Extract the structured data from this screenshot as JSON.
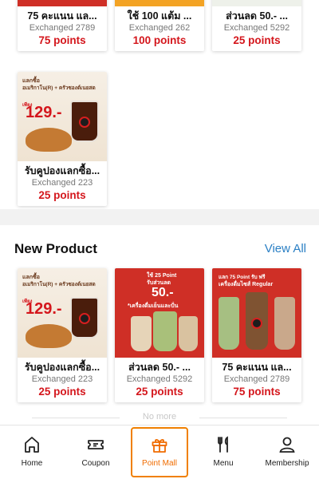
{
  "top_row": [
    {
      "name": "75 คะแนน แล...",
      "exchanged": "Exchanged 2789",
      "points": "75 points"
    },
    {
      "name": "ใช้ 100 แต้ม ...",
      "exchanged": "Exchanged 262",
      "points": "100 points"
    },
    {
      "name": "ส่วนลด 50.- ...",
      "exchanged": "Exchanged 5292",
      "points": "25 points"
    }
  ],
  "single_card": {
    "name": "รับคูปองแลกซื้อ...",
    "exchanged": "Exchanged 223",
    "points": "25 points",
    "promo_line1": "แลกซื้อ",
    "promo_line2": "อเมริกาโน(R) + ครัวซองต์เนยสด",
    "price_prefix": "เพียง",
    "price": "129.-"
  },
  "new_product": {
    "title": "New Product",
    "view_all": "View All",
    "items": [
      {
        "name": "รับคูปองแลกซื้อ...",
        "exchanged": "Exchanged 223",
        "points": "25 points",
        "promo_line1": "แลกซื้อ",
        "promo_line2": "อเมริกาโน(R) + ครัวซองต์เนยสด",
        "price_prefix": "เพียง",
        "price": "129.-"
      },
      {
        "name": "ส่วนลด 50.- ...",
        "exchanged": "Exchanged 5292",
        "points": "25 points",
        "promo_line1": "ใช้ 25 Point",
        "promo_line2": "รับส่วนลด",
        "promo_amount": "50.-",
        "promo_line3": "*เครื่องดื่มเย็นและปั่น"
      },
      {
        "name": "75 คะแนน แล...",
        "exchanged": "Exchanged 2789",
        "points": "75 points",
        "promo_line1": "แลก 75 Point รับ ฟรี",
        "promo_line2": "เครื่องดื่มไซส์ Regular"
      }
    ]
  },
  "no_more": "No more",
  "tabbar": [
    {
      "label": "Home",
      "icon": "home-icon"
    },
    {
      "label": "Coupon",
      "icon": "ticket-icon"
    },
    {
      "label": "Point Mall",
      "icon": "gift-icon",
      "active": true
    },
    {
      "label": "Menu",
      "icon": "fork-knife-icon"
    },
    {
      "label": "Membership",
      "icon": "person-icon"
    }
  ],
  "colors": {
    "points": "#d4161c",
    "link": "#2a7fc4",
    "active_tab": "#f06c00"
  }
}
